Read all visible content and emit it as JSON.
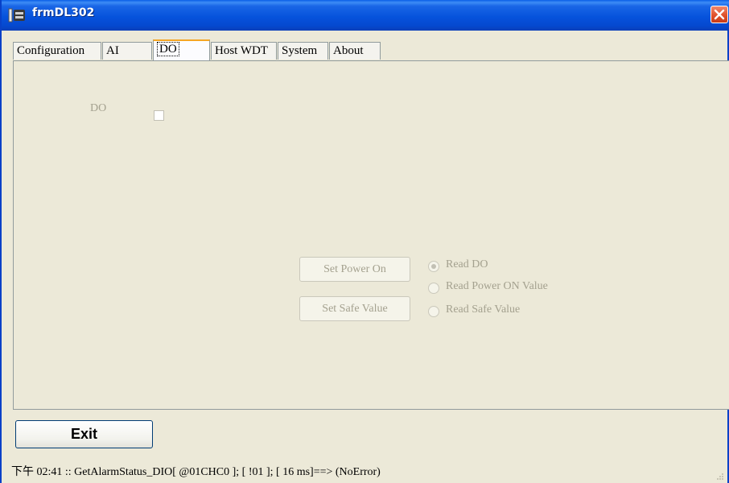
{
  "window": {
    "title": "frmDL302"
  },
  "tabs": [
    {
      "label": "Configuration"
    },
    {
      "label": "AI"
    },
    {
      "label": "DO"
    },
    {
      "label": "Host WDT"
    },
    {
      "label": "System"
    },
    {
      "label": "About"
    }
  ],
  "do_panel": {
    "do_label": "DO",
    "do_checked": false,
    "set_power_on_label": "Set Power On",
    "set_safe_value_label": "Set Safe Value",
    "radio_read_do": "Read DO",
    "radio_read_power_on": "Read Power ON Value",
    "radio_read_safe": "Read Safe Value",
    "selected_radio": "Read DO"
  },
  "exit_label": "Exit",
  "status": "下午 02:41 :: GetAlarmStatus_DIO[ @01CHC0 ]; [ !01 ]; [ 16 ms]==> (NoError)"
}
